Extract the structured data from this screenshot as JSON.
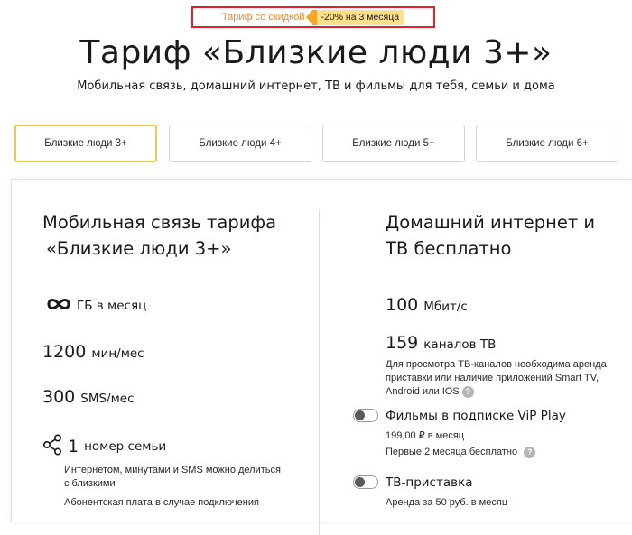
{
  "promo": {
    "label": "Тариф со скидкой",
    "badge": "-20% на 3 месяца",
    "accent": "#f5a623",
    "frame_color": "#e0212a"
  },
  "header": {
    "title": "Тариф «Близкие люди 3+»",
    "subtitle": "Мобильная связь, домашний интернет, ТВ и фильмы для тебя, семьи и дома"
  },
  "tabs": [
    {
      "label": "Близкие люди 3+",
      "active": true
    },
    {
      "label": "Близкие люди 4+",
      "active": false
    },
    {
      "label": "Близкие люди 5+",
      "active": false
    },
    {
      "label": "Близкие люди 6+",
      "active": false
    }
  ],
  "mobile": {
    "heading_line1": "Мобильная связь тарифа",
    "heading_line2": "«Близкие люди 3+»",
    "data": {
      "icon": "infinity-icon",
      "unit": "ГБ в месяц"
    },
    "minutes": {
      "value": "1200",
      "unit": "мин/мес"
    },
    "sms": {
      "value": "300",
      "unit": "SMS/мес"
    },
    "family": {
      "icon": "share-icon",
      "value": "1",
      "unit": "номер семьи"
    },
    "family_note": "Интернетом, минутами и SMS можно делиться с близкими",
    "fee_note": "Абонентская плата в случае подключения"
  },
  "home": {
    "heading_line1": "Домашний интернет и",
    "heading_line2": "ТВ бесплатно",
    "speed": {
      "value": "100",
      "unit": "Мбит/с"
    },
    "channels": {
      "value": "159",
      "unit": "каналов ТВ"
    },
    "channels_note": "Для просмотра ТВ-каналов необходима аренда приставки или наличие приложений Smart TV, Android или IOS",
    "options": [
      {
        "label": "Фильмы в подписке ViP Play",
        "price": "199,00 ₽ в месяц",
        "extra": "Первые 2 месяца бесплатно"
      },
      {
        "label": "ТВ-приставка",
        "price": "Аренда за 50 руб. в месяц"
      }
    ]
  },
  "help_glyph": "?"
}
